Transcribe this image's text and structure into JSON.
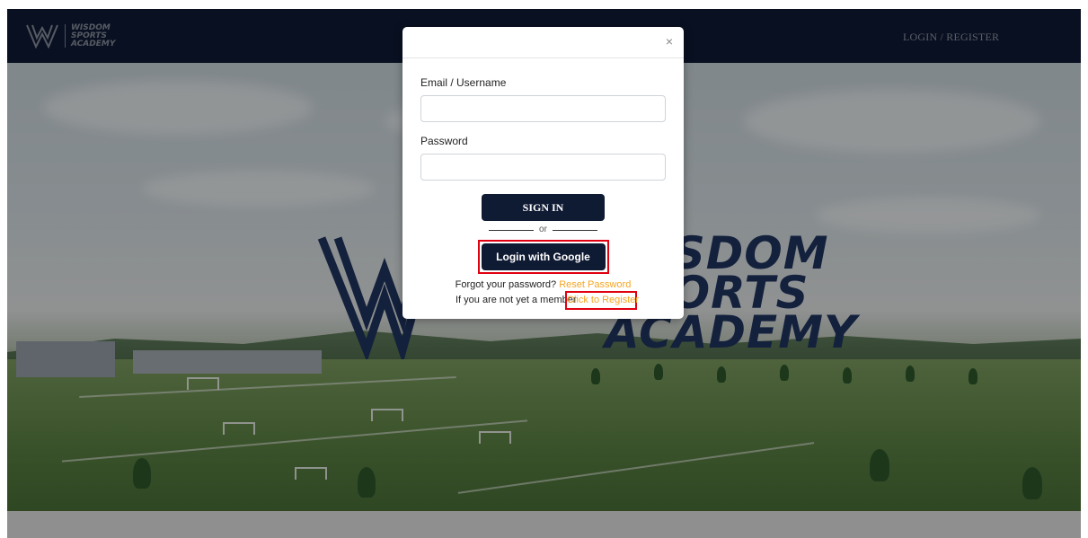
{
  "header": {
    "brand_line1": "WISDOM",
    "brand_line2": "SPORTS",
    "brand_line3": "ACADEMY",
    "login_register": "LOGIN / REGISTER"
  },
  "hero": {
    "logo_line1": "WISDOM",
    "logo_line2": "SPORTS",
    "logo_line3": "ACADEMY"
  },
  "modal": {
    "close_glyph": "×",
    "email_label": "Email / Username",
    "email_value": "",
    "password_label": "Password",
    "password_value": "",
    "signin_label": "SIGN IN",
    "or_text": "or",
    "google_label": "Login with Google",
    "forgot_text": "Forgot your password?",
    "reset_link": "Reset Password",
    "not_member_text": "If you are not yet a member",
    "register_link": "Click to Register"
  },
  "colors": {
    "navy": "#0f1a33",
    "accent_orange": "#f5a623",
    "highlight_red": "#e0000f"
  }
}
